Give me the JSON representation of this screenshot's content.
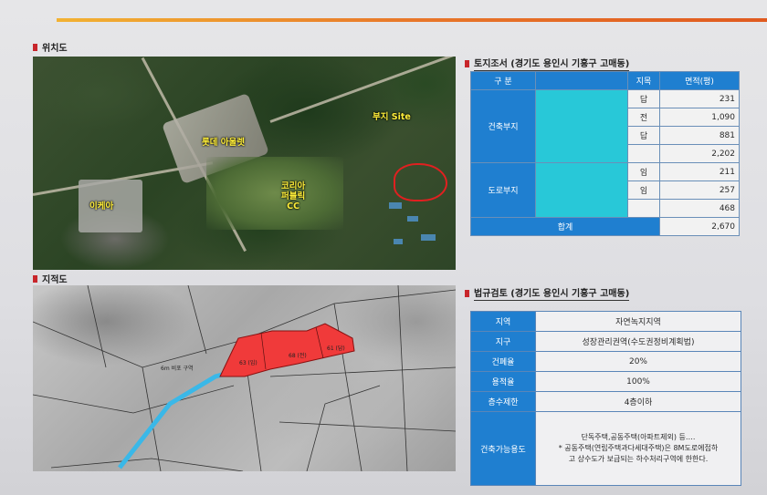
{
  "sections": {
    "location": "위치도",
    "cadastral": "지적도",
    "land_survey": "토지조서 (경기도 용인시 기흥구 고매동)",
    "legal_review": "법규검토 (경기도 용인시 기흥구 고매동)"
  },
  "map_labels": {
    "site": "부지 Site",
    "lotte": "롯데 아울렛",
    "ikea": "이케아",
    "golf": "코리아\n퍼블릭\nCC"
  },
  "land_table": {
    "headers": [
      "구 분",
      "",
      "지목",
      "면적(평)"
    ],
    "groups": [
      {
        "label": "건축부지",
        "rows": [
          {
            "jimok": "답",
            "area": "231"
          },
          {
            "jimok": "전",
            "area": "1,090"
          },
          {
            "jimok": "답",
            "area": "881"
          },
          {
            "jimok": "",
            "area": "2,202"
          }
        ]
      },
      {
        "label": "도로부지",
        "rows": [
          {
            "jimok": "임",
            "area": "211"
          },
          {
            "jimok": "임",
            "area": "257"
          },
          {
            "jimok": "",
            "area": "468"
          }
        ]
      }
    ],
    "total_label": "합계",
    "total_value": "2,670"
  },
  "legal_table": {
    "rows": [
      {
        "key": "지역",
        "value": "자연녹지지역"
      },
      {
        "key": "지구",
        "value": "성장관리권역(수도권정비계획법)"
      },
      {
        "key": "건폐율",
        "value": "20%"
      },
      {
        "key": "용적율",
        "value": "100%"
      },
      {
        "key": "층수제한",
        "value": "4층이하"
      }
    ],
    "usage_key": "건축가능용도",
    "usage_lines": [
      "단독주택,공동주택(아파트제외) 등….",
      "* 공동주택(연립주택과다세대주택)은 8M도로에접하",
      "고 상수도가 보급되는 하수처리구역에 한한다."
    ]
  },
  "cadastral_labels": {
    "road": "6m 비포 구역",
    "p1": "63 (임)",
    "p2": "68 (전)",
    "p3": "61 (답)"
  },
  "colors": {
    "accent_blue": "#1f7fd0",
    "site_red": "#f03a3a",
    "road_cyan": "#3ab8e8",
    "mask_cyan": "#28c8d8"
  }
}
